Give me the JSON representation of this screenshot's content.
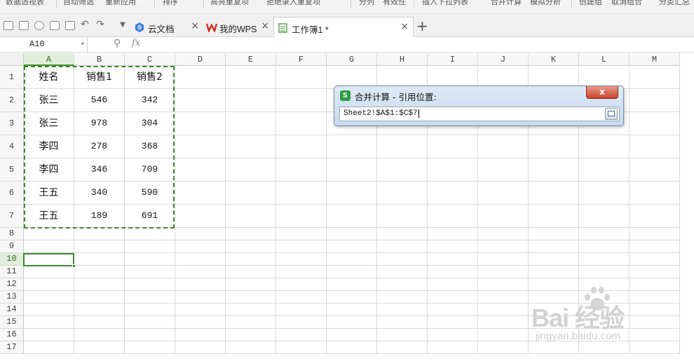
{
  "ribbon": {
    "items": [
      "数据透视表",
      "自动筛选",
      "重新应用",
      "排序",
      "高亮重复项",
      "拒绝录入重复项",
      "分列",
      "有效性",
      "插入下拉列表",
      "合并计算",
      "模拟分析",
      "创建组",
      "取消组合",
      "分类汇总"
    ]
  },
  "tabs": [
    {
      "label": "云文档",
      "close": "×"
    },
    {
      "label": "我的WPS",
      "close": "×"
    },
    {
      "label": "工作簿1 *",
      "close": "×"
    }
  ],
  "new_tab_label": "+",
  "formula_bar": {
    "name_box": "A10",
    "fx_label": "fx",
    "formula": ""
  },
  "columns": [
    "A",
    "B",
    "C",
    "D",
    "E",
    "F",
    "G",
    "H",
    "I",
    "J",
    "K",
    "L",
    "M"
  ],
  "rows": [
    "1",
    "2",
    "3",
    "4",
    "5",
    "6",
    "7",
    "8",
    "9",
    "10",
    "11",
    "12",
    "13",
    "14",
    "15",
    "16",
    "17"
  ],
  "cells": [
    [
      "姓名",
      "销售1",
      "销售2"
    ],
    [
      "张三",
      "546",
      "342"
    ],
    [
      "张三",
      "978",
      "304"
    ],
    [
      "李四",
      "278",
      "368"
    ],
    [
      "李四",
      "346",
      "709"
    ],
    [
      "王五",
      "340",
      "590"
    ],
    [
      "王五",
      "189",
      "691"
    ]
  ],
  "selected_column": "A",
  "selected_row": "10",
  "dialog": {
    "icon_label": "S",
    "title": "合并计算 - 引用位置:",
    "close_label": "x",
    "reference": "Sheet2!$A$1:$C$7"
  },
  "watermark": {
    "text": "Bai 经验",
    "sub": "jingyan.baidu.com"
  },
  "colors": {
    "selection_green": "#3d8a2a",
    "header_highlight": "#e1eedb",
    "dialog_bg": "#c9daee",
    "close_red": "#c8442c"
  }
}
